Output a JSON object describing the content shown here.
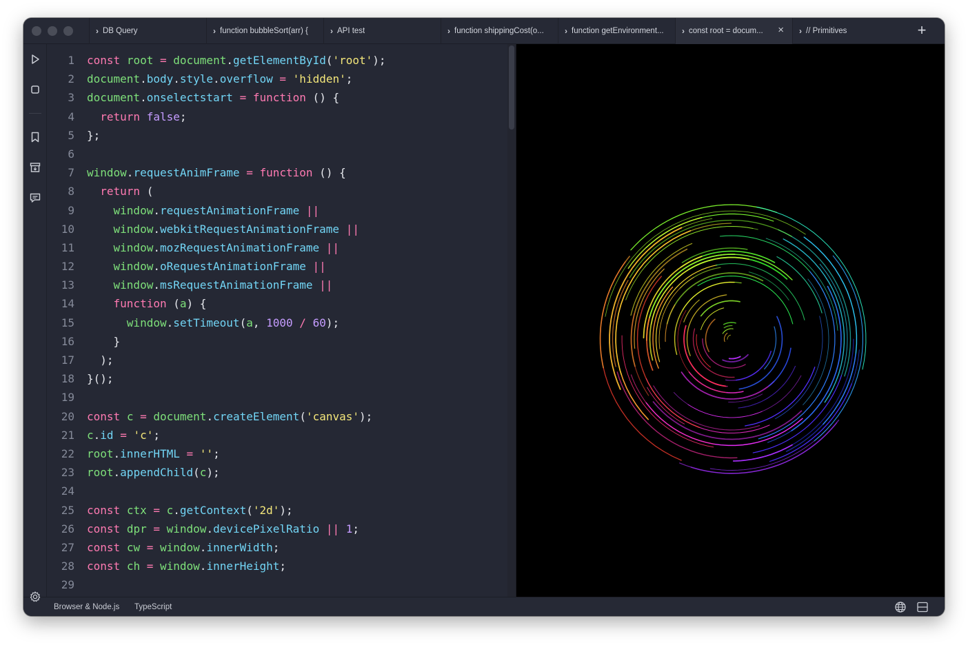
{
  "tabs": [
    {
      "label": "DB Query",
      "active": false
    },
    {
      "label": "function bubbleSort(arr) {",
      "active": false
    },
    {
      "label": "API test",
      "active": false
    },
    {
      "label": "function shippingCost(o...",
      "active": false
    },
    {
      "label": "function getEnvironment...",
      "active": false
    },
    {
      "label": "const root = docum...",
      "active": true
    },
    {
      "label": "// Primitives",
      "active": false
    }
  ],
  "tab_close_glyph": "×",
  "new_tab_glyph": "+",
  "rail_icons": [
    "run-icon",
    "stop-icon",
    "bookmark-icon",
    "archive-icon",
    "comment-icon",
    "settings-icon"
  ],
  "status": {
    "runtime": "Browser & Node.js",
    "language": "TypeScript"
  },
  "code_lines": [
    [
      [
        "kw",
        "const"
      ],
      [
        "pu",
        " "
      ],
      [
        "va",
        "root"
      ],
      [
        "pu",
        " "
      ],
      [
        "op",
        "="
      ],
      [
        "pu",
        " "
      ],
      [
        "va",
        "document"
      ],
      [
        "pu",
        "."
      ],
      [
        "pr",
        "getElementById"
      ],
      [
        "pu",
        "("
      ],
      [
        "st",
        "'root'"
      ],
      [
        "pu",
        ");"
      ]
    ],
    [
      [
        "va",
        "document"
      ],
      [
        "pu",
        "."
      ],
      [
        "pr",
        "body"
      ],
      [
        "pu",
        "."
      ],
      [
        "pr",
        "style"
      ],
      [
        "pu",
        "."
      ],
      [
        "pr",
        "overflow"
      ],
      [
        "pu",
        " "
      ],
      [
        "op",
        "="
      ],
      [
        "pu",
        " "
      ],
      [
        "st",
        "'hidden'"
      ],
      [
        "pu",
        ";"
      ]
    ],
    [
      [
        "va",
        "document"
      ],
      [
        "pu",
        "."
      ],
      [
        "pr",
        "onselectstart"
      ],
      [
        "pu",
        " "
      ],
      [
        "op",
        "="
      ],
      [
        "pu",
        " "
      ],
      [
        "kw",
        "function"
      ],
      [
        "pu",
        " () {"
      ]
    ],
    [
      [
        "pu",
        "  "
      ],
      [
        "kw",
        "return"
      ],
      [
        "pu",
        " "
      ],
      [
        "nu",
        "false"
      ],
      [
        "pu",
        ";"
      ]
    ],
    [
      [
        "pu",
        "};"
      ]
    ],
    [],
    [
      [
        "va",
        "window"
      ],
      [
        "pu",
        "."
      ],
      [
        "pr",
        "requestAnimFrame"
      ],
      [
        "pu",
        " "
      ],
      [
        "op",
        "="
      ],
      [
        "pu",
        " "
      ],
      [
        "kw",
        "function"
      ],
      [
        "pu",
        " () {"
      ]
    ],
    [
      [
        "pu",
        "  "
      ],
      [
        "kw",
        "return"
      ],
      [
        "pu",
        " ("
      ]
    ],
    [
      [
        "pu",
        "    "
      ],
      [
        "va",
        "window"
      ],
      [
        "pu",
        "."
      ],
      [
        "pr",
        "requestAnimationFrame"
      ],
      [
        "pu",
        " "
      ],
      [
        "op",
        "||"
      ]
    ],
    [
      [
        "pu",
        "    "
      ],
      [
        "va",
        "window"
      ],
      [
        "pu",
        "."
      ],
      [
        "pr",
        "webkitRequestAnimationFrame"
      ],
      [
        "pu",
        " "
      ],
      [
        "op",
        "||"
      ]
    ],
    [
      [
        "pu",
        "    "
      ],
      [
        "va",
        "window"
      ],
      [
        "pu",
        "."
      ],
      [
        "pr",
        "mozRequestAnimationFrame"
      ],
      [
        "pu",
        " "
      ],
      [
        "op",
        "||"
      ]
    ],
    [
      [
        "pu",
        "    "
      ],
      [
        "va",
        "window"
      ],
      [
        "pu",
        "."
      ],
      [
        "pr",
        "oRequestAnimationFrame"
      ],
      [
        "pu",
        " "
      ],
      [
        "op",
        "||"
      ]
    ],
    [
      [
        "pu",
        "    "
      ],
      [
        "va",
        "window"
      ],
      [
        "pu",
        "."
      ],
      [
        "pr",
        "msRequestAnimationFrame"
      ],
      [
        "pu",
        " "
      ],
      [
        "op",
        "||"
      ]
    ],
    [
      [
        "pu",
        "    "
      ],
      [
        "kw",
        "function"
      ],
      [
        "pu",
        " ("
      ],
      [
        "va",
        "a"
      ],
      [
        "pu",
        ") {"
      ]
    ],
    [
      [
        "pu",
        "      "
      ],
      [
        "va",
        "window"
      ],
      [
        "pu",
        "."
      ],
      [
        "pr",
        "setTimeout"
      ],
      [
        "pu",
        "("
      ],
      [
        "va",
        "a"
      ],
      [
        "pu",
        ", "
      ],
      [
        "nu",
        "1000"
      ],
      [
        "pu",
        " "
      ],
      [
        "op",
        "/"
      ],
      [
        "pu",
        " "
      ],
      [
        "nu",
        "60"
      ],
      [
        "pu",
        ");"
      ]
    ],
    [
      [
        "pu",
        "    }"
      ]
    ],
    [
      [
        "pu",
        "  );"
      ]
    ],
    [
      [
        "pu",
        "}();"
      ]
    ],
    [],
    [
      [
        "kw",
        "const"
      ],
      [
        "pu",
        " "
      ],
      [
        "va",
        "c"
      ],
      [
        "pu",
        " "
      ],
      [
        "op",
        "="
      ],
      [
        "pu",
        " "
      ],
      [
        "va",
        "document"
      ],
      [
        "pu",
        "."
      ],
      [
        "pr",
        "createElement"
      ],
      [
        "pu",
        "("
      ],
      [
        "st",
        "'canvas'"
      ],
      [
        "pu",
        ");"
      ]
    ],
    [
      [
        "va",
        "c"
      ],
      [
        "pu",
        "."
      ],
      [
        "pr",
        "id"
      ],
      [
        "pu",
        " "
      ],
      [
        "op",
        "="
      ],
      [
        "pu",
        " "
      ],
      [
        "st",
        "'c'"
      ],
      [
        "pu",
        ";"
      ]
    ],
    [
      [
        "va",
        "root"
      ],
      [
        "pu",
        "."
      ],
      [
        "pr",
        "innerHTML"
      ],
      [
        "pu",
        " "
      ],
      [
        "op",
        "="
      ],
      [
        "pu",
        " "
      ],
      [
        "st",
        "''"
      ],
      [
        "pu",
        ";"
      ]
    ],
    [
      [
        "va",
        "root"
      ],
      [
        "pu",
        "."
      ],
      [
        "pr",
        "appendChild"
      ],
      [
        "pu",
        "("
      ],
      [
        "va",
        "c"
      ],
      [
        "pu",
        ");"
      ]
    ],
    [],
    [
      [
        "kw",
        "const"
      ],
      [
        "pu",
        " "
      ],
      [
        "va",
        "ctx"
      ],
      [
        "pu",
        " "
      ],
      [
        "op",
        "="
      ],
      [
        "pu",
        " "
      ],
      [
        "va",
        "c"
      ],
      [
        "pu",
        "."
      ],
      [
        "pr",
        "getContext"
      ],
      [
        "pu",
        "("
      ],
      [
        "st",
        "'2d'"
      ],
      [
        "pu",
        ");"
      ]
    ],
    [
      [
        "kw",
        "const"
      ],
      [
        "pu",
        " "
      ],
      [
        "va",
        "dpr"
      ],
      [
        "pu",
        " "
      ],
      [
        "op",
        "="
      ],
      [
        "pu",
        " "
      ],
      [
        "va",
        "window"
      ],
      [
        "pu",
        "."
      ],
      [
        "pr",
        "devicePixelRatio"
      ],
      [
        "pu",
        " "
      ],
      [
        "op",
        "||"
      ],
      [
        "pu",
        " "
      ],
      [
        "nu",
        "1"
      ],
      [
        "pu",
        ";"
      ]
    ],
    [
      [
        "kw",
        "const"
      ],
      [
        "pu",
        " "
      ],
      [
        "va",
        "cw"
      ],
      [
        "pu",
        " "
      ],
      [
        "op",
        "="
      ],
      [
        "pu",
        " "
      ],
      [
        "va",
        "window"
      ],
      [
        "pu",
        "."
      ],
      [
        "pr",
        "innerWidth"
      ],
      [
        "pu",
        ";"
      ]
    ],
    [
      [
        "kw",
        "const"
      ],
      [
        "pu",
        " "
      ],
      [
        "va",
        "ch"
      ],
      [
        "pu",
        " "
      ],
      [
        "op",
        "="
      ],
      [
        "pu",
        " "
      ],
      [
        "va",
        "window"
      ],
      [
        "pu",
        "."
      ],
      [
        "pr",
        "innerHeight"
      ],
      [
        "pu",
        ";"
      ]
    ],
    []
  ]
}
